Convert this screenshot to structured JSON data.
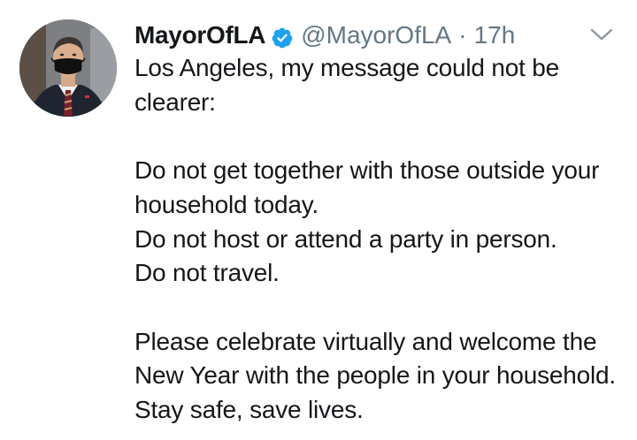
{
  "tweet": {
    "display_name": "MayorOfLA",
    "handle": "@MayorOfLA",
    "separator": "·",
    "timestamp": "17h",
    "verified": true,
    "text": "Los Angeles, my message could not be clearer:\n\nDo not get together with those outside your household today.\nDo not host or attend a party in person.\nDo not travel.\n\nPlease celebrate virtually and welcome the New Year with the people in your household. Stay safe, save lives.",
    "icons": {
      "verified": "verified-badge-icon",
      "menu": "chevron-down-icon"
    },
    "colors": {
      "verified_badge": "#1da1f2",
      "secondary_text": "#657786",
      "primary_text": "#14171a"
    }
  }
}
